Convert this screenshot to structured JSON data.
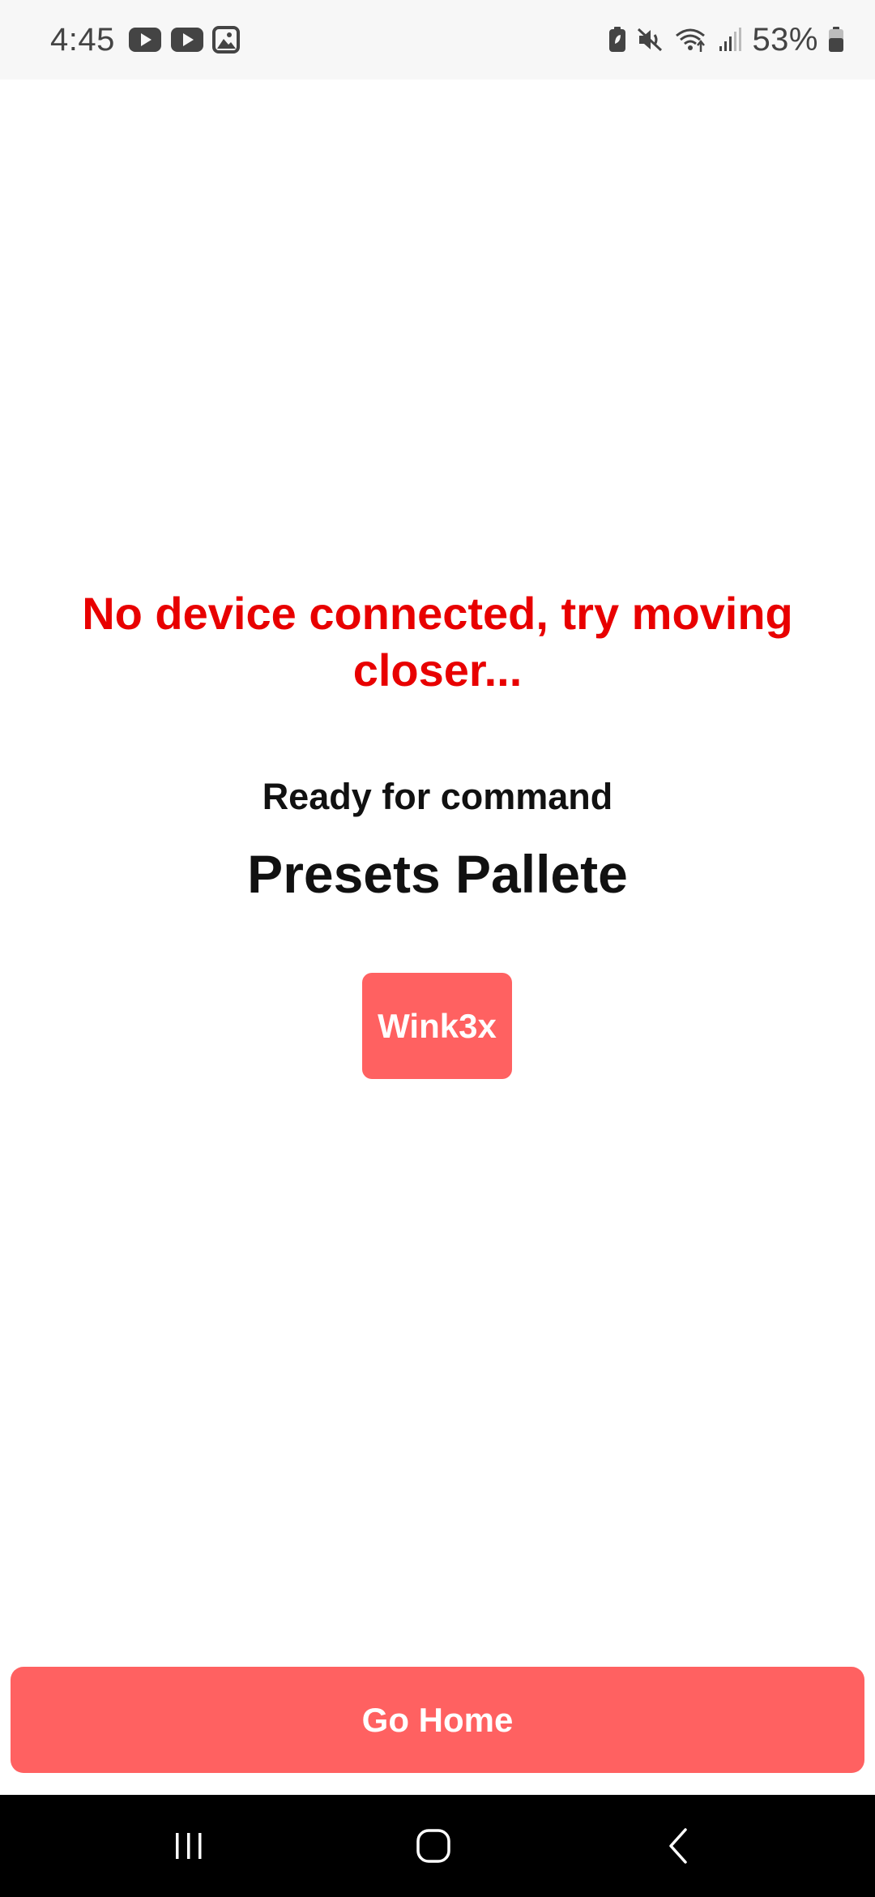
{
  "status_bar": {
    "time": "4:45",
    "battery_percent": "53%",
    "left_icons": [
      "youtube-icon",
      "youtube-icon",
      "gallery-icon"
    ],
    "right_icons": [
      "battery-saver-icon",
      "mute-icon",
      "wifi-icon",
      "signal-icon",
      "battery-icon"
    ]
  },
  "main": {
    "connection_status": "No device connected, try moving closer...",
    "ready_text": "Ready for command",
    "title": "Presets Pallete",
    "presets": [
      {
        "label": "Wink3x"
      }
    ],
    "go_home_label": "Go Home"
  },
  "nav_bar": {
    "buttons": [
      "recents-icon",
      "home-icon",
      "back-icon"
    ]
  },
  "colors": {
    "accent": "#ff6161",
    "error": "#e80000",
    "text": "#111111",
    "status_bar_bg": "#f7f7f7",
    "nav_bg": "#000000"
  }
}
